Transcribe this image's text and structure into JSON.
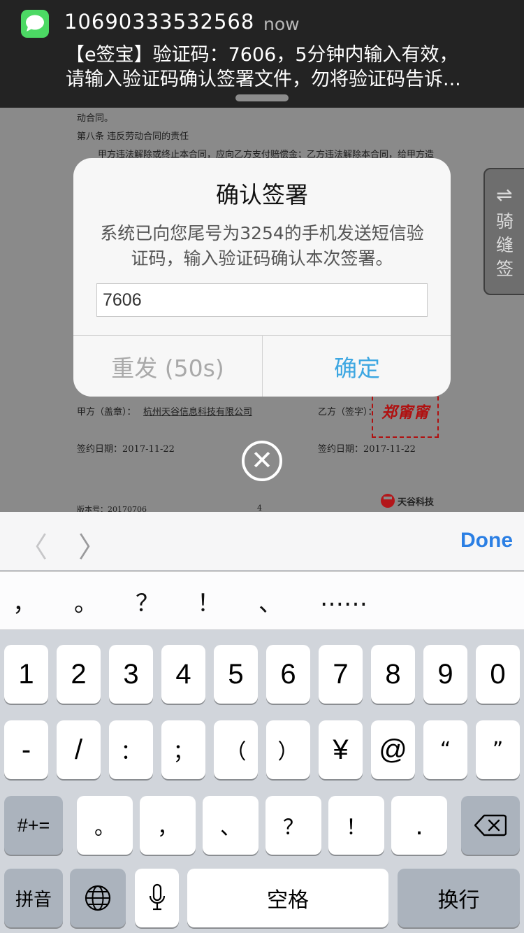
{
  "notification": {
    "sender": "10690333532568",
    "time": "now",
    "line1": "【e签宝】验证码：7606，5分钟内输入有效，",
    "line2": "请输入验证码确认签署文件，勿将验证码告诉..."
  },
  "document": {
    "line1": "动合同。",
    "line2": "第八条    违反劳动合同的责任",
    "line3": "甲方违法解除或终止本合同，应向乙方支付赔偿金；乙方违法解除本合同，给甲方造",
    "party_a_label": "甲方（盖章）：",
    "party_a_name": "杭州天谷信息科技有限公司",
    "party_b_label": "乙方（签字）：",
    "date_a": "签约日期：2017-11-22",
    "date_b": "签约日期：2017-11-22",
    "version": "版本号：20170706",
    "page_number": "4",
    "logo_text": "天谷科技",
    "signature": "郑甯甯"
  },
  "side_tab": {
    "arrow": "⇌",
    "label": "骑缝签"
  },
  "alert": {
    "title": "确认签署",
    "message": "系统已向您尾号为3254的手机发送短信验证码，输入验证码确认本次签署。",
    "input_value": "7606",
    "resend_label": "重发 (50s)",
    "confirm_label": "确定"
  },
  "close_glyph": "✕",
  "accessory": {
    "prev": "〈",
    "next": "〉",
    "done": "Done"
  },
  "keyboard": {
    "candidates": [
      "，",
      "。",
      "？",
      "！",
      "、",
      "……"
    ],
    "row1": [
      "1",
      "2",
      "3",
      "4",
      "5",
      "6",
      "7",
      "8",
      "9",
      "0"
    ],
    "row2": [
      "-",
      "/",
      "：",
      "；",
      "（",
      "）",
      "¥",
      "@",
      "“",
      "”"
    ],
    "row3": [
      "#+=",
      "。",
      "，",
      "、",
      "？",
      "！",
      ".",
      "⌫"
    ],
    "row4": [
      "拼音",
      "🌐",
      "🎤",
      "空格",
      "换行"
    ]
  }
}
